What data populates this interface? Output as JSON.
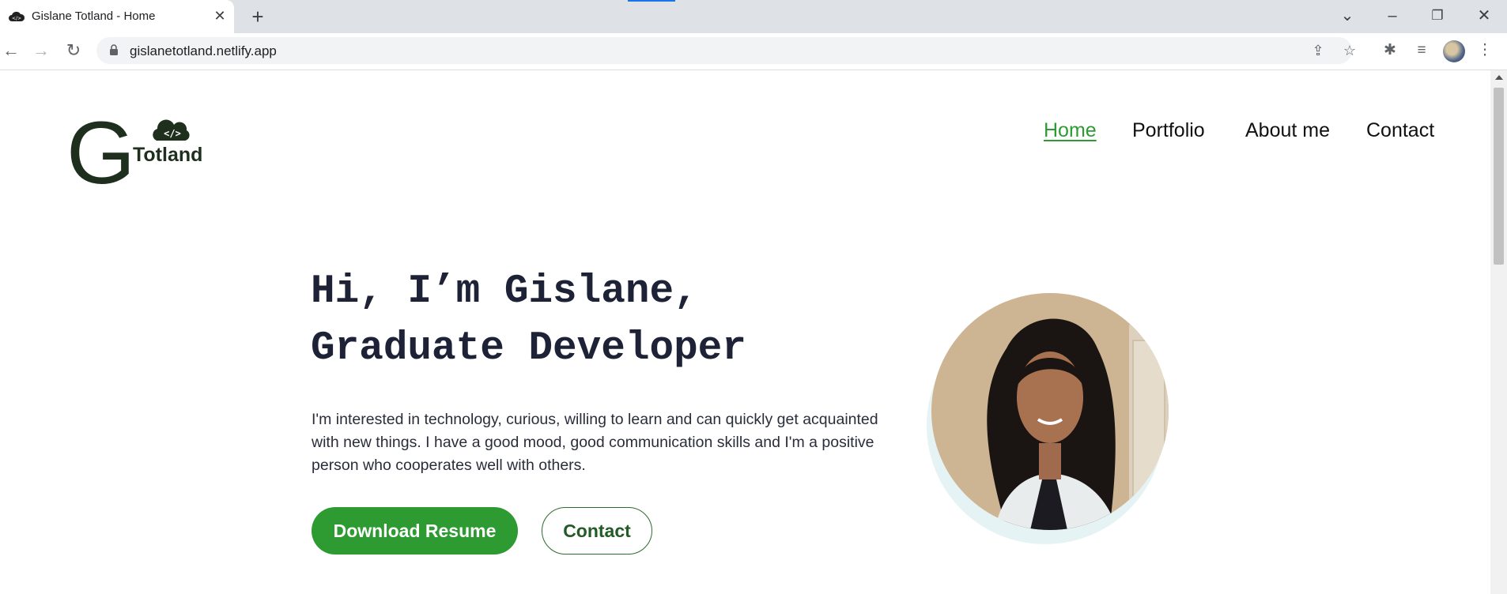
{
  "browser": {
    "tab_title": "Gislane Totland - Home",
    "url": "gislanetotland.netlify.app"
  },
  "site": {
    "logo_text": "Totland",
    "logo_letter": "G",
    "logo_code": "</>",
    "nav": [
      {
        "label": "Home",
        "active": true
      },
      {
        "label": "Portfolio",
        "active": false
      },
      {
        "label": "About me",
        "active": false
      },
      {
        "label": "Contact",
        "active": false
      }
    ]
  },
  "hero": {
    "headline_line1": "Hi, I’m Gislane,",
    "headline_line2": "Graduate Developer",
    "intro": "I'm interested in technology, curious, willing to learn and can quickly get acquainted with new things. I have a good mood, good communication skills and I'm a positive person who cooperates well with others.",
    "primary_button": "Download Resume",
    "secondary_button": "Contact"
  },
  "colors": {
    "accent_green": "#2e9b32",
    "heading_navy": "#1e2236"
  }
}
